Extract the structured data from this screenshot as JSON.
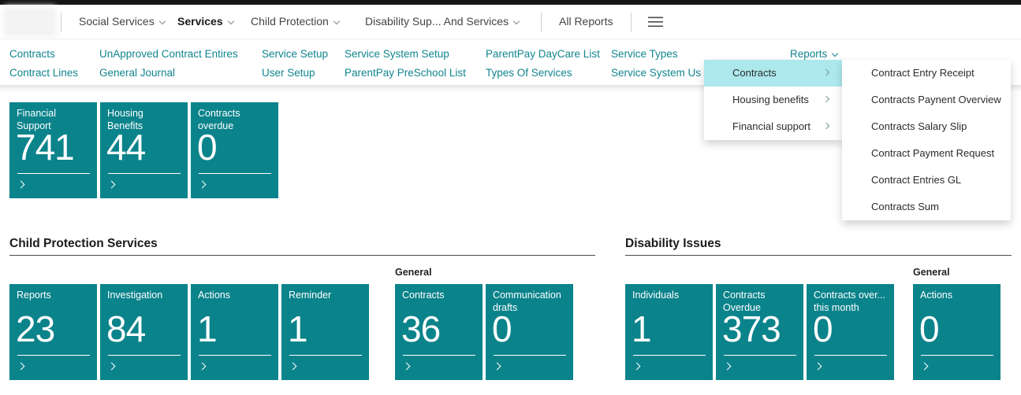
{
  "colors": {
    "tile_teal": "#0b838b",
    "link_teal": "#11858e",
    "menu_highlight": "#ace8ec",
    "top_strip": "#151515"
  },
  "topnav": {
    "items": [
      {
        "label": "Social Services"
      },
      {
        "label": "Services"
      },
      {
        "label": "Child Protection"
      },
      {
        "label": "Disability Sup... And Services"
      },
      {
        "label": "All Reports"
      }
    ]
  },
  "ribbon": {
    "columns": [
      {
        "row1": "Contracts",
        "row2": "Contract Lines"
      },
      {
        "row1": "UnApproved Contract Entires",
        "row2": "General Journal"
      },
      {
        "row1": "Service Setup",
        "row2": "User Setup"
      },
      {
        "row1": "Service System Setup",
        "row2": "ParentPay PreSchool List"
      },
      {
        "row1": "ParentPay DayCare List",
        "row2": "Types Of Services"
      },
      {
        "row1": "Service Types",
        "row2": "Service System Us"
      }
    ],
    "reports_label": "Reports"
  },
  "reports_menu": {
    "items": [
      {
        "label": "Contracts"
      },
      {
        "label": "Housing benefits"
      },
      {
        "label": "Financial support"
      }
    ],
    "submenu_items": [
      {
        "label": "Contract Entry Receipt"
      },
      {
        "label": "Contracts Paynent Overview"
      },
      {
        "label": "Contracts Salary Slip"
      },
      {
        "label": "Contract Payment Request"
      },
      {
        "label": "Contract Entries GL"
      },
      {
        "label": "Contracts Sum"
      }
    ]
  },
  "cues": {
    "top_tiles": [
      {
        "label": "Financial\nSupport",
        "value": "741"
      },
      {
        "label": "Housing\nBenefits",
        "value": "44"
      },
      {
        "label": "Contracts\noverdue",
        "value": "0"
      }
    ],
    "child_protection": {
      "title": "Child Protection Services",
      "group_label": "General",
      "tiles": [
        {
          "label": "Reports",
          "value": "23"
        },
        {
          "label": "Investigation",
          "value": "84"
        },
        {
          "label": "Actions",
          "value": "1"
        },
        {
          "label": "Reminder",
          "value": "1"
        }
      ],
      "general_tiles": [
        {
          "label": "Contracts",
          "value": "36"
        },
        {
          "label": "Communication\ndrafts",
          "value": "0"
        }
      ]
    },
    "disability": {
      "title": "Disability Issues",
      "group_label": "General",
      "tiles": [
        {
          "label": "Individuals",
          "value": "1"
        },
        {
          "label": "Contracts\nOverdue",
          "value": "373"
        },
        {
          "label": "Contracts over...\nthis month",
          "value": "0"
        }
      ],
      "general_tiles": [
        {
          "label": "Actions",
          "value": "0"
        }
      ]
    }
  }
}
